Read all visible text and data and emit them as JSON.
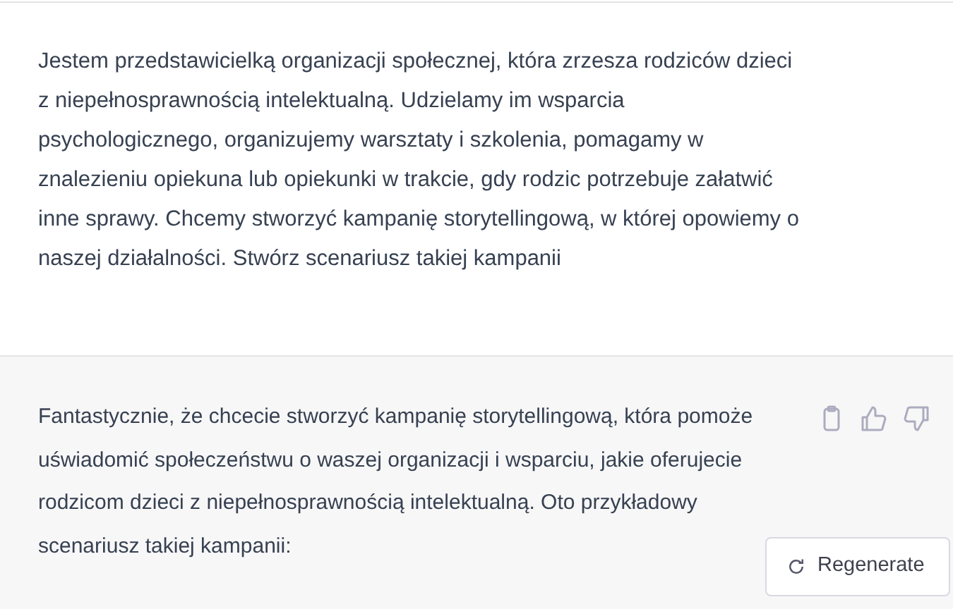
{
  "messages": [
    {
      "kind": "prompt",
      "text": "Jestem przedstawicielką organizacji społecznej, która zrzesza rodziców dzieci z niepełnosprawnością intelektualną. Udzielamy im wsparcia psychologicznego, organizujemy warsztaty i szkolenia, pomagamy w znalezieniu opiekuna lub opiekunki w trakcie, gdy rodzic potrzebuje załatwić inne sprawy. Chcemy stworzyć kampanię storytellingową, w której opowiemy o naszej działalności. Stwórz scenariusz takiej kampanii"
    },
    {
      "kind": "reply",
      "text": "Fantastycznie, że chcecie stworzyć kampanię storytellingową, która pomoże uświadomić społeczeństwu o waszej organizacji i wsparciu, jakie oferujecie rodzicom dzieci z niepełnosprawnością intelektualną. Oto przykładowy scenariusz takiej kampanii:"
    }
  ],
  "regenerate_button": {
    "label": "Regenerate"
  }
}
